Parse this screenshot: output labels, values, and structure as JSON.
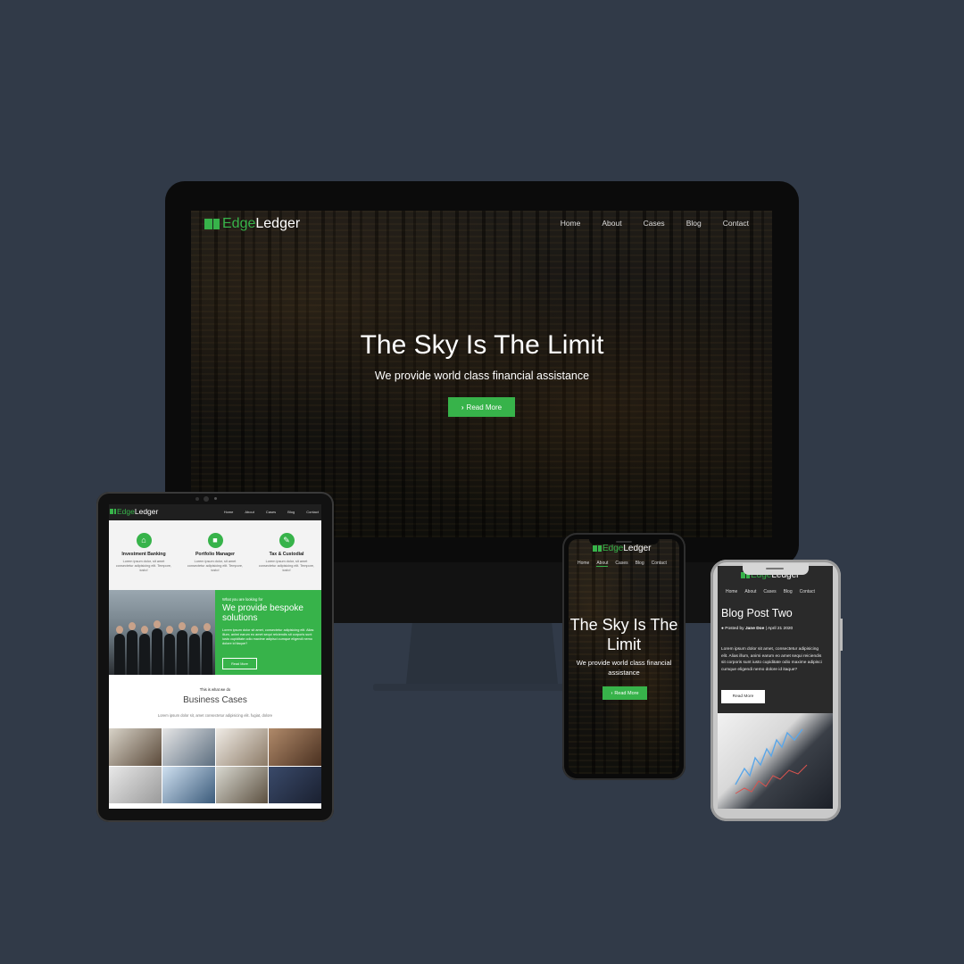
{
  "brand": {
    "edge": "Edge",
    "ledger": "Ledger",
    "logo_icon": "book-icon"
  },
  "colors": {
    "background": "#313a48",
    "accent": "#37b34a"
  },
  "nav": [
    "Home",
    "About",
    "Cases",
    "Blog",
    "Contact"
  ],
  "desktop": {
    "hero_title": "The Sky Is The Limit",
    "hero_subtitle": "We provide world class financial assistance",
    "button": "Read More",
    "button_icon": "chevron-right-icon"
  },
  "tablet": {
    "services": [
      {
        "icon": "bank-icon",
        "name": "Investment Banking",
        "desc": "Lorem ipsum dolor, sit amet consectetur adipisicing elit. Tempore, iusto!"
      },
      {
        "icon": "briefcase-icon",
        "name": "Portfolio Manager",
        "desc": "Lorem ipsum dolor, sit amet consectetur adipisicing elit. Tempore, iusto!"
      },
      {
        "icon": "pencil-icon",
        "name": "Tax & Custodial",
        "desc": "Lorem ipsum dolor, sit amet consectetur adipisicing elit. Tempore, iusto!"
      }
    ],
    "bespoke_kicker": "What you are looking for",
    "bespoke_heading": "We provide bespoke solutions",
    "bespoke_text": "Lorem ipsum dolor sit amet, consectetur adipisicing elit. Alias illum, animi earum eo amet sequi reiciendis sit corporis sunt iusto cupiditate odio maxime adipisci cumque eligendi nemo dolore id itaque?",
    "bespoke_button": "Read More",
    "cases_kicker": "This is what we do",
    "cases_heading": "Business Cases",
    "cases_text": "Lorem ipsum dolor sit, amet consectetur adipisicing elit. fugiat, dolore"
  },
  "phone1": {
    "hero_title": "The Sky Is The Limit",
    "hero_subtitle": "We provide world class financial assistance",
    "button": "Read More"
  },
  "phone2": {
    "post_title": "Blog Post Two",
    "posted_by": "Posted by",
    "author": "Jane Doe",
    "date": "April 21 2020",
    "body": "Lorem ipsum dolor sit amet, consectetur adipisicing elit. Alias illum, animi earum eo amet sequi reiciendis sit corporis sunt iusto cupiditate odio maxime adipisci cumque eligendi nemo dolore id itaque?",
    "button": "Read More",
    "user_icon": "user-icon"
  }
}
